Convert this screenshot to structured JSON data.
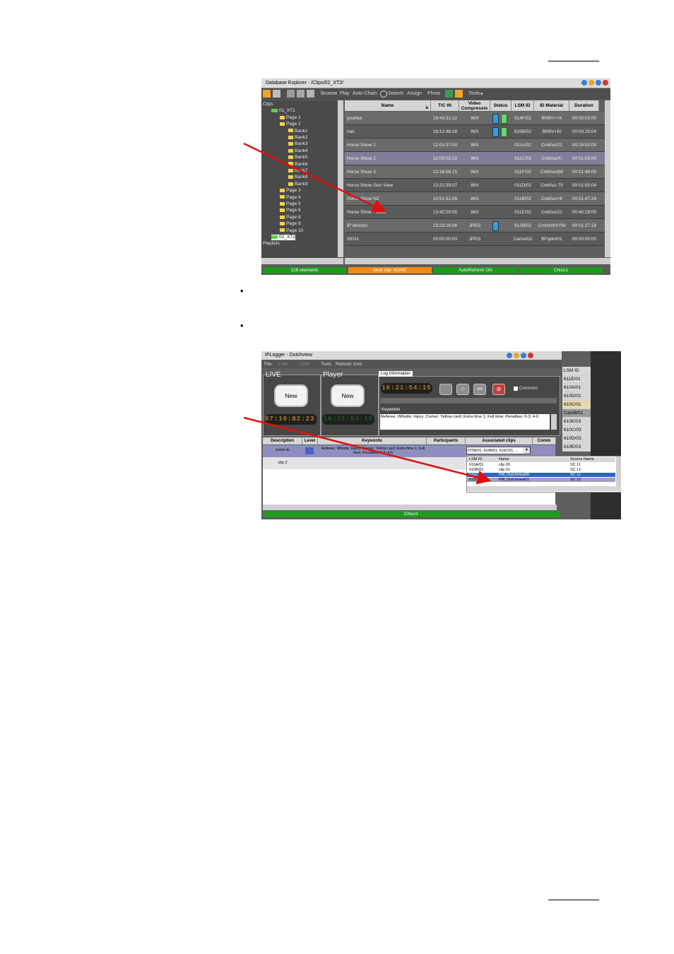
{
  "page": {
    "bullets": [
      "•",
      "•"
    ]
  },
  "db_explorer": {
    "title": "Database Explorer - /Clips/02_XT2/",
    "toolbar": [
      "Browse",
      "Play",
      "Auto-Chain",
      "Search",
      "Assign",
      "Photo",
      "Tools"
    ],
    "tree": [
      {
        "label": "Clips",
        "type": "root"
      },
      {
        "label": "01_XT1",
        "type": "server"
      },
      {
        "label": "Page 1",
        "type": "page"
      },
      {
        "label": "Page 2",
        "type": "page"
      },
      {
        "label": "Bank1",
        "type": "bank"
      },
      {
        "label": "Bank2",
        "type": "bank"
      },
      {
        "label": "Bank3",
        "type": "bank"
      },
      {
        "label": "Bank4",
        "type": "bank"
      },
      {
        "label": "Bank5",
        "type": "bank"
      },
      {
        "label": "Bank6",
        "type": "bank"
      },
      {
        "label": "Bank7",
        "type": "bank"
      },
      {
        "label": "Bank8",
        "type": "bank"
      },
      {
        "label": "Bank9",
        "type": "bank"
      },
      {
        "label": "Page 3",
        "type": "page"
      },
      {
        "label": "Page 4",
        "type": "page"
      },
      {
        "label": "Page 5",
        "type": "page"
      },
      {
        "label": "Page 6",
        "type": "page"
      },
      {
        "label": "Page 8",
        "type": "page"
      },
      {
        "label": "Page 9",
        "type": "page"
      },
      {
        "label": "Page 10",
        "type": "page"
      },
      {
        "label": "02_XT2",
        "type": "server-selected"
      },
      {
        "label": "Playlists",
        "type": "root"
      }
    ],
    "columns": [
      "Name",
      "T/C IN",
      "Video Compressio",
      "Status",
      "LSM ID",
      "ID Material",
      "Duration"
    ],
    "sort_indicator": "à",
    "rows": [
      {
        "name": "gnahke",
        "tcin": "16:43:31:12",
        "video": "IMX",
        "status": "blue-green",
        "lsm": "614F/02",
        "idmat": "BfrBV++X",
        "dur": "00:00:03:00"
      },
      {
        "name": "hair",
        "tcin": "18:12:48:18",
        "video": "IMX",
        "status": "blue-green",
        "lsm": "615B/02",
        "idmat": "BfrBV+Ki",
        "dur": "00:00:25:04"
      },
      {
        "name": "Horse Show 1",
        "tcin": "12:03:37:00",
        "video": "IMX",
        "status": "",
        "lsm": "011A/02",
        "idmat": "Cnb0uz21",
        "dur": "00:29:53:00"
      },
      {
        "name": "Horse Show 2",
        "tcin": "12:09:02:23",
        "video": "IMX",
        "status": "",
        "lsm": "011C/02",
        "idmat": "Cnb0uzXi",
        "dur": "00:01:05:04"
      },
      {
        "name": "Horse Show 3",
        "tcin": "12:16:08:15",
        "video": "IMX",
        "status": "",
        "lsm": "011F/02",
        "idmat": "Cnb0uzqW",
        "dur": "00:01:48:05"
      },
      {
        "name": "Horse Show Gen View",
        "tcin": "12:22:39:07",
        "video": "IMX",
        "status": "",
        "lsm": "011D/02",
        "idmat": "Cnb0uz-70",
        "dur": "00:01:50:04"
      },
      {
        "name": "Horse Show NZ",
        "tcin": "10:51:51:08",
        "video": "IMX",
        "status": "",
        "lsm": "011B/02",
        "idmat": "Cnb0uz+8",
        "dur": "00:01:47:24"
      },
      {
        "name": "Horse Show Public",
        "tcin": "10:42:29:05",
        "video": "IMX",
        "status": "",
        "lsm": "011E/02",
        "idmat": "Cnb0uz21",
        "dur": "00:40:19:05"
      },
      {
        "name": "IP director",
        "tcin": "15:23:16:06",
        "video": "JPEG",
        "status": "blue",
        "lsm": "912B/02",
        "idmat": "CmHzWXYW",
        "dur": "00:01:27:19"
      },
      {
        "name": "IS031",
        "tcin": "00:00:00:00",
        "video": "JPEG",
        "status": "",
        "lsm": "CamA/02",
        "idmat": "BFqdmH1",
        "dur": "00:00:00:00"
      }
    ],
    "statusbar": [
      "126 elements",
      "Next clip: NONE",
      "AutoRefresh ON",
      "Chico1"
    ],
    "colors": {
      "status_green": "#1c9a1c",
      "status_orange": "#f08a12",
      "row_selected": "#7f7f99"
    }
  },
  "ip_logger": {
    "title": "IPLogger - Dutchview",
    "menu": [
      "File",
      "LSM",
      "LSM",
      "Tools",
      "Refresh Grid"
    ],
    "live_label": "LIVE",
    "player_label": "Player",
    "new_label": "New",
    "live_tc": "07:10:02:23.",
    "player_tc": "16:21:54:15",
    "log_tab": "Log Information",
    "log_tc": "16:21:54:15",
    "comment_label": "Comment",
    "keywords_label": "Keywords",
    "keywords_text": "Referee; Whistle; Injury; Corner; Yellow card; Extra time 1; Full time; Penalties; 0-3; 4-0",
    "table_cols": [
      "Description",
      "Level",
      "Keywords",
      "Participants",
      "Associated clips",
      "Comm"
    ],
    "row1": {
      "desc": "zoom in",
      "kw": "Referee; Whistle; Injury; Corner; Yellow card; Extra time 1; Full time; Penalties; 0-3; 4-0",
      "clips": "6T5B/01, 615B/01, 615C/01, ..."
    },
    "row2": {
      "desc": "clip 2"
    },
    "lsm_col": [
      "LSM ID",
      "611E/01",
      "610A/01",
      "610D/01",
      "610C/01",
      "CamB/01",
      "610E/03",
      "610C/03",
      "610D/03",
      "610E/03"
    ],
    "popup_cols": [
      "LSM ID",
      "Name",
      "Source Name"
    ],
    "popup_rows": [
      [
        "615A/01",
        "clip 00",
        "SC 11"
      ],
      [
        "615B/01",
        "clip 01",
        "SC 12"
      ],
      [
        "615C/01",
        "PM_Dutchview00",
        "SC 11"
      ],
      [
        "615D/01",
        "PM_Dutchview01",
        "SC 12"
      ]
    ],
    "statusbar": "Chico1"
  }
}
